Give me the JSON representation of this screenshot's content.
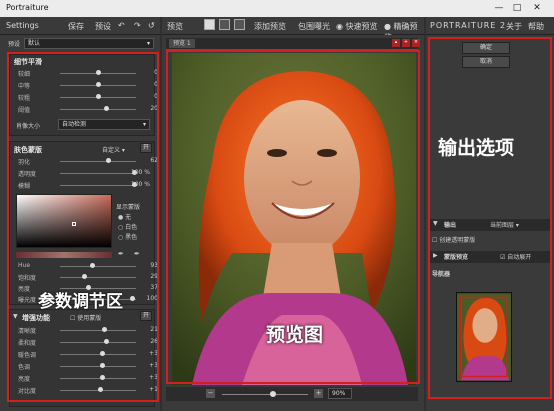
{
  "window": {
    "title": "Portraiture"
  },
  "left_header": {
    "title": "Settings",
    "save": "保存",
    "presets": "预设"
  },
  "mid_header": {
    "title": "预览",
    "add_preview": "添加预览",
    "tab_preview": "预览 1",
    "clip": "包围曝光",
    "fast_preview": "快速预览",
    "accurate_preview": "精确预览"
  },
  "right_header": {
    "logo": "PORTRAITURE",
    "version": "2",
    "about": "关于",
    "help": "帮助"
  },
  "preset": {
    "label": "预设",
    "value": "默认"
  },
  "detail": {
    "title": "细节平滑",
    "rows": [
      {
        "name": "较细",
        "value": "0"
      },
      {
        "name": "中等",
        "value": "0"
      },
      {
        "name": "较粗",
        "value": "0"
      },
      {
        "name": "阈值",
        "value": "20"
      }
    ],
    "size_label": "肖像大小",
    "size_value": "自动检测"
  },
  "mask": {
    "title": "肤色蒙版",
    "mode": "自定义",
    "toggle": "开",
    "rows": [
      {
        "name": "羽化",
        "value": "62"
      },
      {
        "name": "透明度",
        "value": "100",
        "unit": "%"
      },
      {
        "name": "模糊",
        "value": "100",
        "unit": "%"
      }
    ],
    "show_label": "显示蒙版",
    "show_options": [
      "无",
      "白色",
      "黑色"
    ],
    "hsv_rows": [
      {
        "name": "Hue",
        "value": "93"
      },
      {
        "name": "饱和度",
        "value": "29"
      },
      {
        "name": "亮度",
        "value": "37"
      },
      {
        "name": "曝光度",
        "value": "100"
      }
    ]
  },
  "enhance": {
    "title": "增强功能",
    "check_label": "使用蒙版",
    "rows": [
      {
        "name": "清晰度",
        "value": "21"
      },
      {
        "name": "柔和度",
        "value": "26"
      },
      {
        "name": "暖色调",
        "value": "+3"
      },
      {
        "name": "色调",
        "value": "+3"
      },
      {
        "name": "亮度",
        "value": "+3"
      },
      {
        "name": "对比度",
        "value": "+1"
      }
    ]
  },
  "output": {
    "ok": "确定",
    "cancel": "取消",
    "title": "输出",
    "target": "当前图层",
    "create_mask": "创建透明蒙版",
    "mask_preview": "蒙版预览",
    "auto_open": "自动展开",
    "navigator": "导航器"
  },
  "zoom": {
    "value": "90%"
  },
  "annotations": {
    "params": "参数调节区",
    "preview": "预览图",
    "output": "输出选项"
  }
}
